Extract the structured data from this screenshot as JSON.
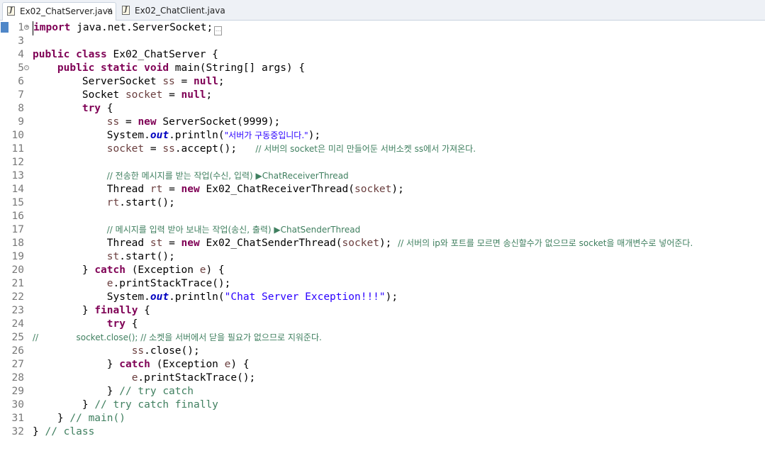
{
  "tabs": [
    {
      "label": "Ex02_ChatServer.java",
      "active": true
    },
    {
      "label": "Ex02_ChatClient.java",
      "active": false
    }
  ],
  "editor": {
    "lines": [
      {
        "n": "1",
        "fold": "+",
        "tokens": [
          [
            "kw",
            "import"
          ],
          [
            "plain",
            " java.net.ServerSocket;"
          ]
        ],
        "elided": true
      },
      {
        "n": "3",
        "tokens": []
      },
      {
        "n": "4",
        "tokens": [
          [
            "kw",
            "public class"
          ],
          [
            "plain",
            " Ex02_ChatServer {"
          ]
        ]
      },
      {
        "n": "5",
        "fold": "-",
        "tokens": [
          [
            "plain",
            "    "
          ],
          [
            "kw",
            "public static void"
          ],
          [
            "plain",
            " main(String[] args) {"
          ]
        ]
      },
      {
        "n": "6",
        "tokens": [
          [
            "plain",
            "        ServerSocket "
          ],
          [
            "var",
            "ss"
          ],
          [
            "plain",
            " = "
          ],
          [
            "kw",
            "null"
          ],
          [
            "plain",
            ";"
          ]
        ]
      },
      {
        "n": "7",
        "tokens": [
          [
            "plain",
            "        Socket "
          ],
          [
            "var",
            "socket"
          ],
          [
            "plain",
            " = "
          ],
          [
            "kw",
            "null"
          ],
          [
            "plain",
            ";"
          ]
        ]
      },
      {
        "n": "8",
        "tokens": [
          [
            "plain",
            "        "
          ],
          [
            "kw",
            "try"
          ],
          [
            "plain",
            " {"
          ]
        ]
      },
      {
        "n": "9",
        "tokens": [
          [
            "plain",
            "            "
          ],
          [
            "var",
            "ss"
          ],
          [
            "plain",
            " = "
          ],
          [
            "kw",
            "new"
          ],
          [
            "plain",
            " ServerSocket(9999);"
          ]
        ]
      },
      {
        "n": "10",
        "tokens": [
          [
            "plain",
            "            System."
          ],
          [
            "fld",
            "out"
          ],
          [
            "plain",
            ".println("
          ],
          [
            "str",
            "\"서버가 구동중입니다.\""
          ],
          [
            "plain",
            ");"
          ]
        ]
      },
      {
        "n": "11",
        "tokens": [
          [
            "plain",
            "            "
          ],
          [
            "var",
            "socket"
          ],
          [
            "plain",
            " = "
          ],
          [
            "var",
            "ss"
          ],
          [
            "plain",
            ".accept();   "
          ],
          [
            "cm",
            "// 서버의 socket은 미리 만들어둔 서버소켓 ss에서 가져온다."
          ]
        ]
      },
      {
        "n": "12",
        "tokens": []
      },
      {
        "n": "13",
        "tokens": [
          [
            "plain",
            "            "
          ],
          [
            "cm",
            "// 전송한 메시지를 받는 작업(수신, 입력) ▶ChatReceiverThread"
          ]
        ]
      },
      {
        "n": "14",
        "tokens": [
          [
            "plain",
            "            Thread "
          ],
          [
            "var",
            "rt"
          ],
          [
            "plain",
            " = "
          ],
          [
            "kw",
            "new"
          ],
          [
            "plain",
            " Ex02_ChatReceiverThread("
          ],
          [
            "var",
            "socket"
          ],
          [
            "plain",
            ");"
          ]
        ]
      },
      {
        "n": "15",
        "tokens": [
          [
            "plain",
            "            "
          ],
          [
            "var",
            "rt"
          ],
          [
            "plain",
            ".start();"
          ]
        ]
      },
      {
        "n": "16",
        "tokens": []
      },
      {
        "n": "17",
        "tokens": [
          [
            "plain",
            "            "
          ],
          [
            "cm",
            "// 메시지를 입력 받아 보내는 작업(송신, 출력) ▶ChatSenderThread"
          ]
        ]
      },
      {
        "n": "18",
        "tokens": [
          [
            "plain",
            "            Thread "
          ],
          [
            "var",
            "st"
          ],
          [
            "plain",
            " = "
          ],
          [
            "kw",
            "new"
          ],
          [
            "plain",
            " Ex02_ChatSenderThread("
          ],
          [
            "var",
            "socket"
          ],
          [
            "plain",
            "); "
          ],
          [
            "cm",
            "// 서버의 ip와 포트를 모르면 송신할수가 없으므로 socket을 매개변수로 넣어준다."
          ]
        ]
      },
      {
        "n": "19",
        "tokens": [
          [
            "plain",
            "            "
          ],
          [
            "var",
            "st"
          ],
          [
            "plain",
            ".start();"
          ]
        ]
      },
      {
        "n": "20",
        "tokens": [
          [
            "plain",
            "        } "
          ],
          [
            "kw",
            "catch"
          ],
          [
            "plain",
            " (Exception "
          ],
          [
            "var",
            "e"
          ],
          [
            "plain",
            ") {"
          ]
        ]
      },
      {
        "n": "21",
        "tokens": [
          [
            "plain",
            "            "
          ],
          [
            "var",
            "e"
          ],
          [
            "plain",
            ".printStackTrace();"
          ]
        ]
      },
      {
        "n": "22",
        "tokens": [
          [
            "plain",
            "            System."
          ],
          [
            "fld",
            "out"
          ],
          [
            "plain",
            ".println("
          ],
          [
            "str",
            "\"Chat Server Exception!!!\""
          ],
          [
            "plain",
            ");"
          ]
        ]
      },
      {
        "n": "23",
        "tokens": [
          [
            "plain",
            "        } "
          ],
          [
            "kw",
            "finally"
          ],
          [
            "plain",
            " {"
          ]
        ]
      },
      {
        "n": "24",
        "tokens": [
          [
            "plain",
            "            "
          ],
          [
            "kw",
            "try"
          ],
          [
            "plain",
            " {"
          ]
        ]
      },
      {
        "n": "25",
        "tokens": [
          [
            "cm",
            "//              socket.close(); // 소켓을 서버에서 닫을 필요가 없으므로 지워준다."
          ]
        ]
      },
      {
        "n": "26",
        "tokens": [
          [
            "plain",
            "                "
          ],
          [
            "var",
            "ss"
          ],
          [
            "plain",
            ".close();"
          ]
        ]
      },
      {
        "n": "27",
        "tokens": [
          [
            "plain",
            "            } "
          ],
          [
            "kw",
            "catch"
          ],
          [
            "plain",
            " (Exception "
          ],
          [
            "var",
            "e"
          ],
          [
            "plain",
            ") {"
          ]
        ]
      },
      {
        "n": "28",
        "tokens": [
          [
            "plain",
            "                "
          ],
          [
            "var",
            "e"
          ],
          [
            "plain",
            ".printStackTrace();"
          ]
        ]
      },
      {
        "n": "29",
        "tokens": [
          [
            "plain",
            "            } "
          ],
          [
            "cm",
            "// try catch"
          ]
        ]
      },
      {
        "n": "30",
        "tokens": [
          [
            "plain",
            "        } "
          ],
          [
            "cm",
            "// try catch finally"
          ]
        ]
      },
      {
        "n": "31",
        "tokens": [
          [
            "plain",
            "    } "
          ],
          [
            "cm",
            "// main()"
          ]
        ]
      },
      {
        "n": "32",
        "tokens": [
          [
            "plain",
            "} "
          ],
          [
            "cm",
            "// class"
          ]
        ]
      }
    ]
  }
}
